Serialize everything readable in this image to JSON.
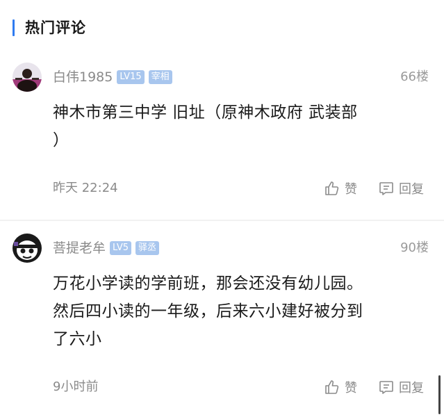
{
  "section": {
    "title": "热门评论"
  },
  "comments": [
    {
      "username": "白伟1985",
      "level": "LV15",
      "rank": "宰相",
      "floor": "66楼",
      "content_lines": [
        "神木市第三中学   旧址（原神木政府   武装部",
        "）"
      ],
      "time": "昨天 22:24",
      "like_label": "赞",
      "reply_label": "回复",
      "avatar_icon": "user-photo-avatar"
    },
    {
      "username": "菩提老牟",
      "level": "LV5",
      "rank": "驿丞",
      "floor": "90楼",
      "content_lines": [
        "万花小学读的学前班，那会还没有幼儿园。",
        "然后四小读的一年级，后来六小建好被分到",
        "了六小"
      ],
      "time": "9小时前",
      "like_label": "赞",
      "reply_label": "回复",
      "avatar_icon": "cartoon-avatar"
    }
  ],
  "colors": {
    "accent": "#2f7bf0",
    "badge": "#a8c6ee",
    "muted": "#8a8a8a",
    "text": "#1a1a1a"
  }
}
